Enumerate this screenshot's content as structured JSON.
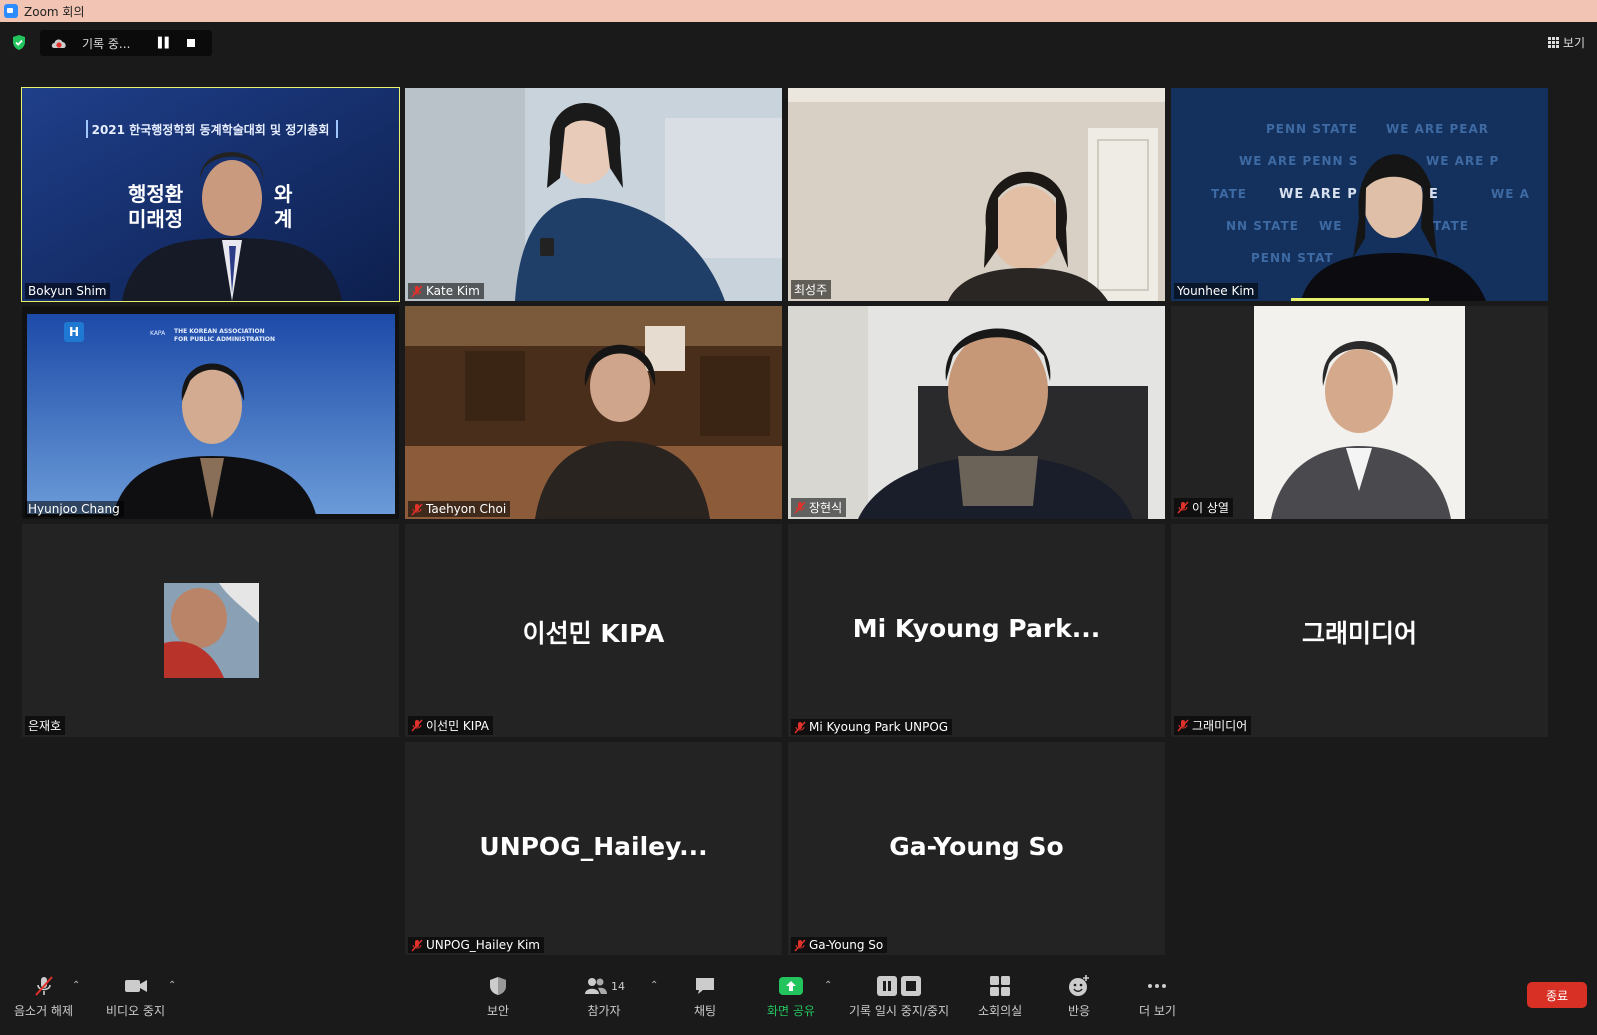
{
  "window": {
    "title": "Zoom 회의"
  },
  "recording": {
    "status": "기록 중..."
  },
  "view_label": "보기",
  "tiles": [
    {
      "name": "Bokyun Shim",
      "muted": false,
      "active": true,
      "banner_title": "2021 한국행정학회 동계학술대회 및 정기총회",
      "banner_line1": "행정환",
      "banner_line1b": "와",
      "banner_line2": "미래정",
      "banner_line2b": "계"
    },
    {
      "name": "Kate Kim",
      "muted": true
    },
    {
      "name": "최성주",
      "muted": false
    },
    {
      "name": "Younhee Kim",
      "muted": false,
      "bg_text": [
        "PENN STATE",
        "WE ARE PEAR",
        "WE ARE PENN S",
        "WE ARE P",
        "TATE",
        "WE ARE P",
        "E",
        "WE A",
        "NN STATE",
        "WE",
        "TATE",
        "PENN STAT"
      ]
    },
    {
      "name": "Hyunjoo Chang",
      "muted": false,
      "logo_letter": "H",
      "org_line1": "THE KOREAN ASSOCIATION",
      "org_line2": "FOR PUBLIC ADMINISTRATION",
      "org_abbr": "KAPA"
    },
    {
      "name": "Taehyon Choi",
      "muted": true
    },
    {
      "name": "장현식",
      "muted": true
    },
    {
      "name": "이 상열",
      "muted": true
    },
    {
      "name": "은재호",
      "muted": false
    },
    {
      "name": "이선민 KIPA",
      "display": "이선민 KIPA",
      "muted": true
    },
    {
      "name": "Mi Kyoung Park UNPOG",
      "display": "Mi Kyoung Park...",
      "muted": true
    },
    {
      "name": "그래미디어",
      "display": "그래미디어",
      "muted": true
    },
    {
      "name": "UNPOG_Hailey Kim",
      "display": "UNPOG_Hailey...",
      "muted": true
    },
    {
      "name": "Ga-Young So",
      "display": "Ga-Young So",
      "muted": true
    }
  ],
  "toolbar": {
    "unmute": "음소거 해제",
    "stop_video": "비디오 중지",
    "security": "보안",
    "participants": "참가자",
    "participants_count": "14",
    "chat": "채팅",
    "share_screen": "화면 공유",
    "record": "기록 일시 중지/중지",
    "breakout": "소회의실",
    "reactions": "반응",
    "more": "더 보기",
    "end": "종료"
  },
  "colors": {
    "active_border": "#e9f26b",
    "share_green": "#23c45e",
    "end_red": "#d93025",
    "title_bar": "#f1c4b4"
  }
}
